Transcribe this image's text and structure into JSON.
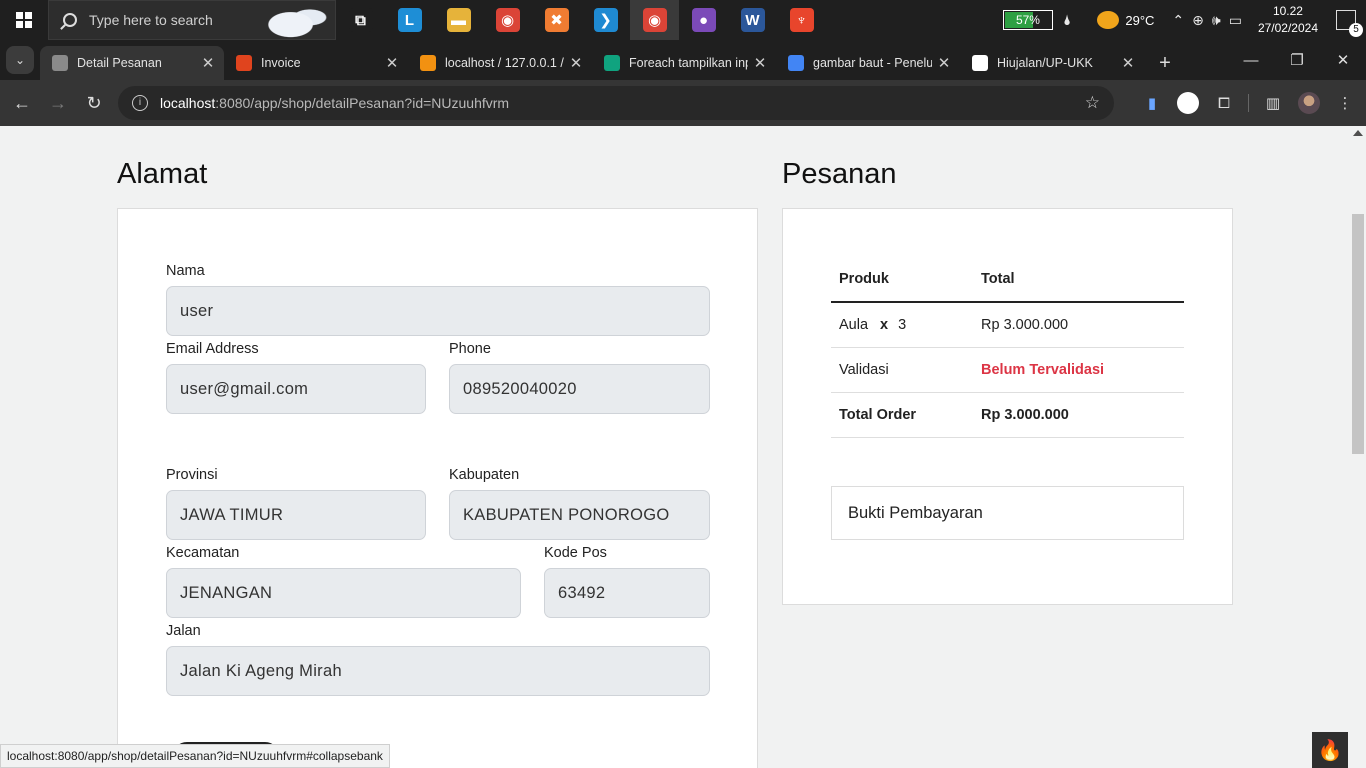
{
  "taskbar": {
    "search_placeholder": "Type here to search",
    "apps": [
      {
        "name": "task-view",
        "glyph": "⧉",
        "color": "#1f1f1f",
        "active": false
      },
      {
        "name": "launcher-l",
        "glyph": "L",
        "color": "#1e8ed6",
        "active": false
      },
      {
        "name": "file-explorer",
        "glyph": "▬",
        "color": "#e6b33a",
        "active": false
      },
      {
        "name": "chrome",
        "glyph": "◉",
        "color": "#db4437",
        "active": false
      },
      {
        "name": "xampp",
        "glyph": "✖",
        "color": "#f07c32",
        "active": false
      },
      {
        "name": "vscode",
        "glyph": "❯",
        "color": "#1f8ad2",
        "active": false
      },
      {
        "name": "chrome-active",
        "glyph": "◉",
        "color": "#db4437",
        "active": true
      },
      {
        "name": "github-desktop",
        "glyph": "●",
        "color": "#7b4ab8",
        "active": false
      },
      {
        "name": "word",
        "glyph": "W",
        "color": "#2b579a",
        "active": false
      },
      {
        "name": "git-tool",
        "glyph": "♆",
        "color": "#e8452c",
        "active": false
      }
    ],
    "battery": "57%",
    "temperature": "29°C",
    "time": "10.22",
    "date": "27/02/2024",
    "notifications": "5"
  },
  "tabs": [
    {
      "title": "Detail Pesanan",
      "favicon_color": "#8a8a8a",
      "active": true
    },
    {
      "title": "Invoice",
      "favicon_color": "#e0441e",
      "active": false
    },
    {
      "title": "localhost / 127.0.0.1 / ",
      "favicon_color": "#f29111",
      "active": false
    },
    {
      "title": "Foreach tampilkan inpu",
      "favicon_color": "#10a37f",
      "active": false
    },
    {
      "title": "gambar baut - Penelus",
      "favicon_color": "#4285f4",
      "active": false
    },
    {
      "title": "Hiujalan/UP-UKK",
      "favicon_color": "#ffffff",
      "active": false
    }
  ],
  "address": {
    "host": "localhost",
    "path": ":8080/app/shop/detailPesanan?id=NUzuuhfvrm"
  },
  "alamat": {
    "heading": "Alamat",
    "nama_label": "Nama",
    "nama_value": "user",
    "email_label": "Email Address",
    "email_value": "user@gmail.com",
    "phone_label": "Phone",
    "phone_value": "089520040020",
    "provinsi_label": "Provinsi",
    "provinsi_value": "JAWA TIMUR",
    "kabupaten_label": "Kabupaten",
    "kabupaten_value": "KABUPATEN PONOROGO",
    "kecamatan_label": "Kecamatan",
    "kecamatan_value": "JENANGAN",
    "kodepos_label": "Kode Pos",
    "kodepos_value": "63492",
    "jalan_label": "Jalan",
    "jalan_value": "Jalan Ki Ageng Mirah"
  },
  "pesanan": {
    "heading": "Pesanan",
    "col_produk": "Produk",
    "col_total": "Total",
    "item_name": "Aula",
    "item_x": "x",
    "item_qty": "3",
    "item_total": "Rp 3.000.000",
    "validasi_label": "Validasi",
    "validasi_value": "Belum Tervalidasi",
    "total_label": "Total Order",
    "total_value": "Rp 3.000.000",
    "bukti_label": "Bukti Pembayaran"
  },
  "status_url": "localhost:8080/app/shop/detailPesanan?id=NUzuuhfvrm#collapsebank"
}
